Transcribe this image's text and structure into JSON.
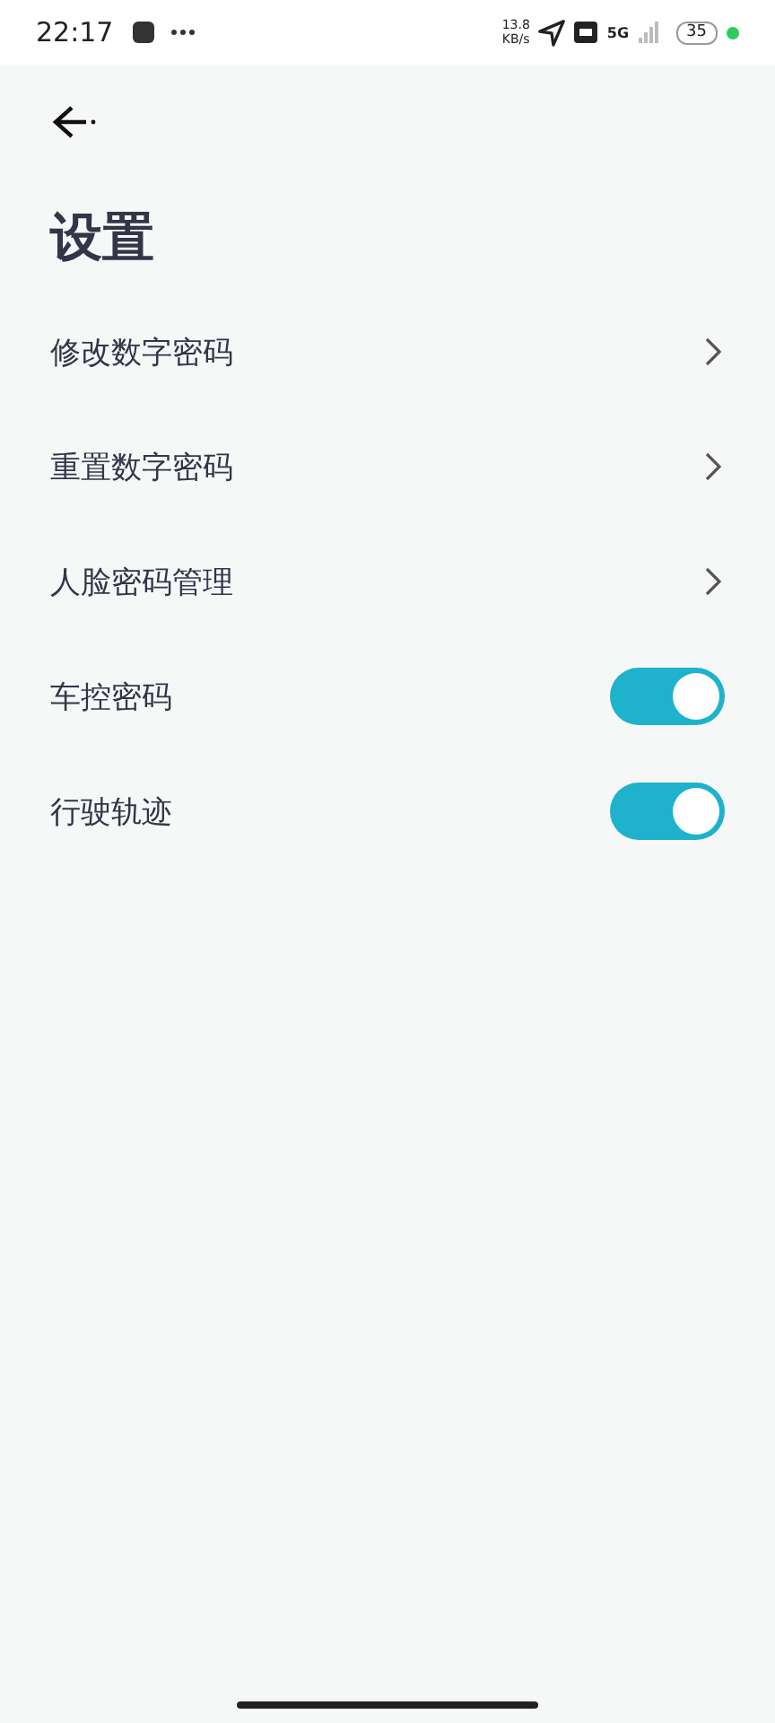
{
  "status_bar": {
    "time": "22:17",
    "net_speed": "13.8",
    "net_unit": "KB/s",
    "network": "5G",
    "battery": "35"
  },
  "header": {
    "title": "设置"
  },
  "settings": [
    {
      "kind": "link",
      "label": "修改数字密码"
    },
    {
      "kind": "link",
      "label": "重置数字密码"
    },
    {
      "kind": "link",
      "label": "人脸密码管理"
    },
    {
      "kind": "toggle",
      "label": "车控密码",
      "on": true
    },
    {
      "kind": "toggle",
      "label": "行驶轨迹",
      "on": true
    }
  ]
}
